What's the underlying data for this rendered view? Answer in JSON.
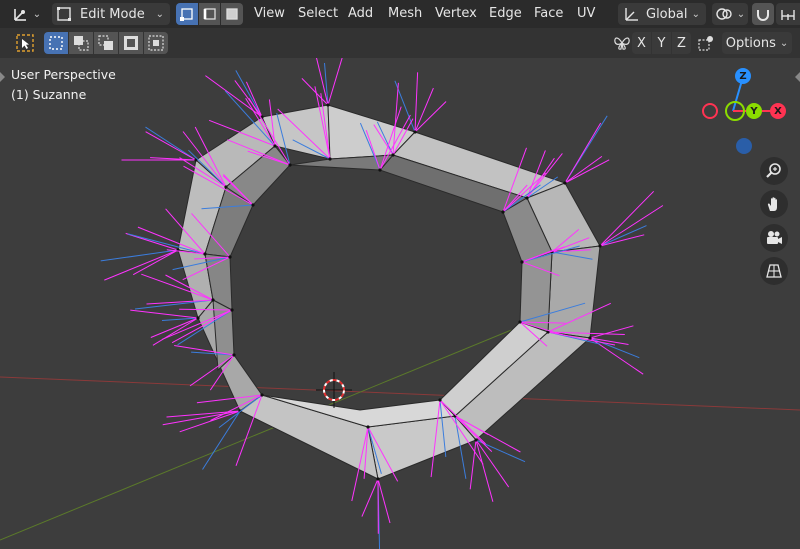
{
  "header": {
    "mode_label": "Edit Mode",
    "menus": [
      "View",
      "Select",
      "Add",
      "Mesh",
      "Vertex",
      "Edge",
      "Face",
      "UV"
    ],
    "transform_orientation": "Global"
  },
  "toolrow": {
    "axis_x": "X",
    "axis_y": "Y",
    "axis_z": "Z",
    "options_label": "Options"
  },
  "viewport": {
    "view_name": "User Perspective",
    "object_name": "(1) Suzanne"
  },
  "gizmo": {
    "z_label": "Z",
    "y_label": "Y",
    "x_label": "X",
    "colors": {
      "x": "#ff3352",
      "y": "#8bdc00",
      "z": "#2890ff"
    }
  },
  "colors": {
    "accent": "#4772b3",
    "normal_face": "#ff33ff",
    "normal_vertex": "#3b7ddd",
    "floor_x_axis": "#8a3a3a",
    "floor_y_axis": "#5b7a2a"
  }
}
